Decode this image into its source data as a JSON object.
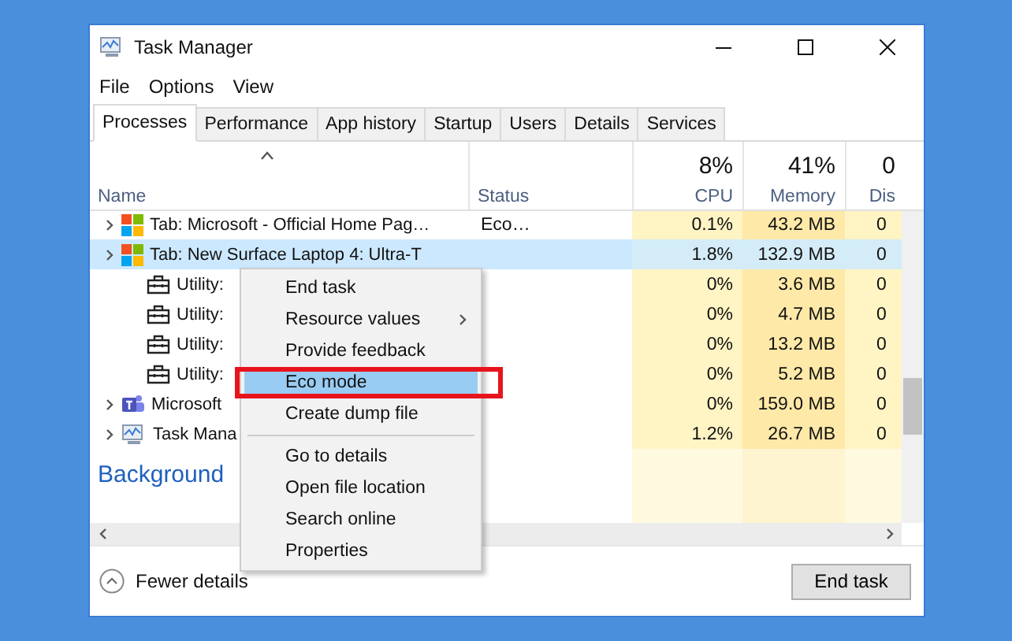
{
  "window": {
    "title": "Task Manager"
  },
  "menu": [
    "File",
    "Options",
    "View"
  ],
  "tabs": [
    {
      "label": "Processes",
      "selected": true
    },
    {
      "label": "Performance",
      "selected": false
    },
    {
      "label": "App history",
      "selected": false
    },
    {
      "label": "Startup",
      "selected": false
    },
    {
      "label": "Users",
      "selected": false
    },
    {
      "label": "Details",
      "selected": false
    },
    {
      "label": "Services",
      "selected": false
    }
  ],
  "columns": [
    {
      "label": "Name"
    },
    {
      "label": "Status"
    },
    {
      "label": "CPU",
      "total": "8%"
    },
    {
      "label": "Memory",
      "total": "41%"
    },
    {
      "label": "Dis",
      "total": "0"
    }
  ],
  "rows": [
    {
      "kind": "tab",
      "name": "Tab: Microsoft - Official Home Pag…",
      "status": "Eco…",
      "cpu": "0.1%",
      "memory": "43.2 MB",
      "disk": "0",
      "expandable": true,
      "selected": false
    },
    {
      "kind": "tab",
      "name": "Tab: New Surface Laptop 4: Ultra-T",
      "cpu": "1.8%",
      "memory": "132.9 MB",
      "disk": "0",
      "expandable": true,
      "selected": true
    },
    {
      "kind": "utility",
      "name": "Utility:",
      "cpu": "0%",
      "memory": "3.6 MB",
      "disk": "0",
      "expandable": false,
      "selected": false
    },
    {
      "kind": "utility",
      "name": "Utility:",
      "cpu": "0%",
      "memory": "4.7 MB",
      "disk": "0",
      "expandable": false,
      "selected": false
    },
    {
      "kind": "utility",
      "name": "Utility:",
      "cpu": "0%",
      "memory": "13.2 MB",
      "disk": "0",
      "expandable": false,
      "selected": false
    },
    {
      "kind": "utility",
      "name": "Utility:",
      "cpu": "0%",
      "memory": "5.2 MB",
      "disk": "0",
      "expandable": false,
      "selected": false
    },
    {
      "kind": "teams",
      "name": "Microsoft",
      "cpu": "0%",
      "memory": "159.0 MB",
      "disk": "0",
      "expandable": true,
      "selected": false
    },
    {
      "kind": "taskmgr",
      "name": "Task Mana",
      "cpu": "1.2%",
      "memory": "26.7 MB",
      "disk": "0",
      "expandable": true,
      "selected": false
    }
  ],
  "group_heading": "Background",
  "context_menu": [
    {
      "kind": "item",
      "label": "End task",
      "selected": false
    },
    {
      "kind": "submenu",
      "label": "Resource values",
      "selected": false
    },
    {
      "kind": "item",
      "label": "Provide feedback",
      "selected": false
    },
    {
      "kind": "item",
      "label": "Eco mode",
      "selected": true
    },
    {
      "kind": "item",
      "label": "Create dump file",
      "selected": false
    },
    {
      "kind": "separator"
    },
    {
      "kind": "item",
      "label": "Go to details",
      "selected": false
    },
    {
      "kind": "item",
      "label": "Open file location",
      "selected": false
    },
    {
      "kind": "item",
      "label": "Search online",
      "selected": false
    },
    {
      "kind": "item",
      "label": "Properties",
      "selected": false
    }
  ],
  "footer": {
    "toggle": "Fewer details",
    "button": "End task"
  }
}
